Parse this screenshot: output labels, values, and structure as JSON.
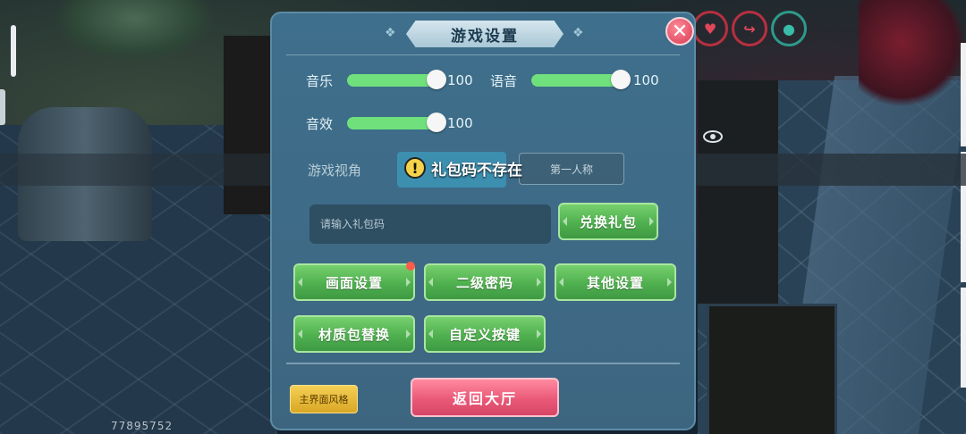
{
  "dialog": {
    "title": "游戏设置",
    "close_icon": "close-x-icon"
  },
  "audio": {
    "music": {
      "label": "音乐",
      "value": "100",
      "level": 1.0
    },
    "voice": {
      "label": "语音",
      "value": "100",
      "level": 1.0
    },
    "effects": {
      "label": "音效",
      "value": "100",
      "level": 1.0
    }
  },
  "view": {
    "label": "游戏视角",
    "option_first_person": "第一人称"
  },
  "toast": {
    "icon": "exclamation-icon",
    "message": "礼包码不存在"
  },
  "gift_code": {
    "placeholder": "请输入礼包码",
    "redeem_label": "兑换礼包"
  },
  "menu_buttons": {
    "graphics": "画面设置",
    "secondary_password": "二级密码",
    "other_settings": "其他设置",
    "texture_pack": "材质包替换",
    "custom_keys": "自定义按键"
  },
  "footer": {
    "ui_style_label": "主界面风格",
    "back_to_lobby_label": "返回大厅"
  },
  "hud": {
    "user_id": "77895752",
    "icons": [
      "heart-icon",
      "share-arrow-icon",
      "water-drop-icon",
      "eye-icon"
    ]
  },
  "colors": {
    "slider_fill": "#6fe07c",
    "green_button": "#4fb04f",
    "lobby_button": "#ea5a78",
    "style_button": "#e6b83a",
    "close_button": "#d83a52"
  }
}
